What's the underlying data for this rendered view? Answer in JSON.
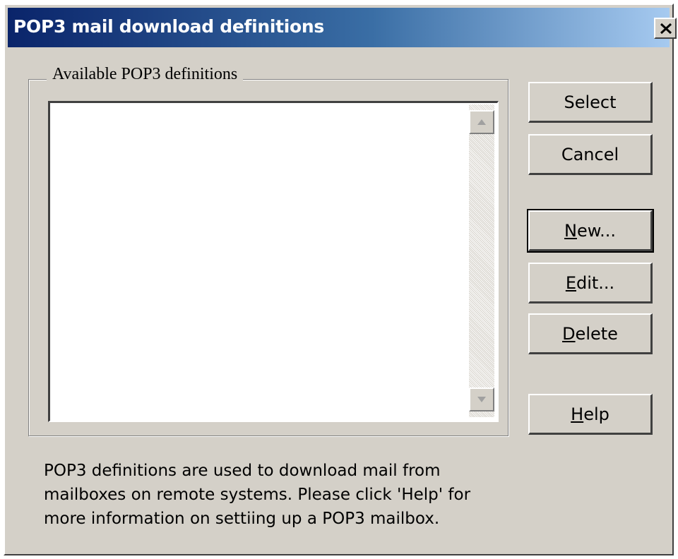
{
  "window": {
    "title": "POP3 mail download definitions",
    "close_label": "Close"
  },
  "group": {
    "label": "Available POP3 definitions",
    "items": []
  },
  "buttons": {
    "select": "Select",
    "cancel": "Cancel",
    "new_prefix": "",
    "new_accel": "N",
    "new_rest": "ew...",
    "edit_prefix": "",
    "edit_accel": "E",
    "edit_rest": "dit...",
    "delete_prefix": "",
    "delete_accel": "D",
    "delete_rest": "elete",
    "help_prefix": "",
    "help_accel": "H",
    "help_rest": "elp"
  },
  "description": {
    "line1": "POP3 definitions are used to download mail from",
    "line2": "mailboxes on remote systems. Please click 'Help' for",
    "line3": "more information on settiing up a POP3 mailbox."
  },
  "icons": {
    "close": "close-icon",
    "scroll_up": "scroll-up-arrow-icon",
    "scroll_down": "scroll-down-arrow-icon"
  },
  "colors": {
    "title_start": "#0a246a",
    "title_end": "#a6caf0",
    "face": "#d4d0c8"
  }
}
